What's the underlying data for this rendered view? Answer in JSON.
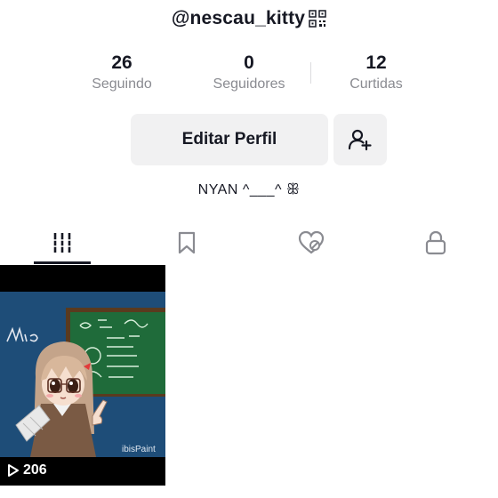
{
  "profile": {
    "username": "@nescau_kitty",
    "bio": "NYAN ^___^ ꕥ"
  },
  "stats": [
    {
      "value": "26",
      "label": "Seguindo"
    },
    {
      "value": "0",
      "label": "Seguidores"
    },
    {
      "value": "12",
      "label": "Curtidas"
    }
  ],
  "actions": {
    "edit_profile_label": "Editar Perfil"
  },
  "tabs": [
    "videos-grid-icon",
    "bookmark-icon",
    "liked-heart-icon",
    "lock-icon"
  ],
  "videos": [
    {
      "views": "206",
      "watermark": "ibisPaint",
      "scribble": "Mio"
    }
  ],
  "colors": {
    "text": "#161823",
    "secondary_text": "#8a8b91",
    "button_bg": "#f1f1f2",
    "chalkboard": "#1f6b3a",
    "wall": "#1e4d78"
  }
}
